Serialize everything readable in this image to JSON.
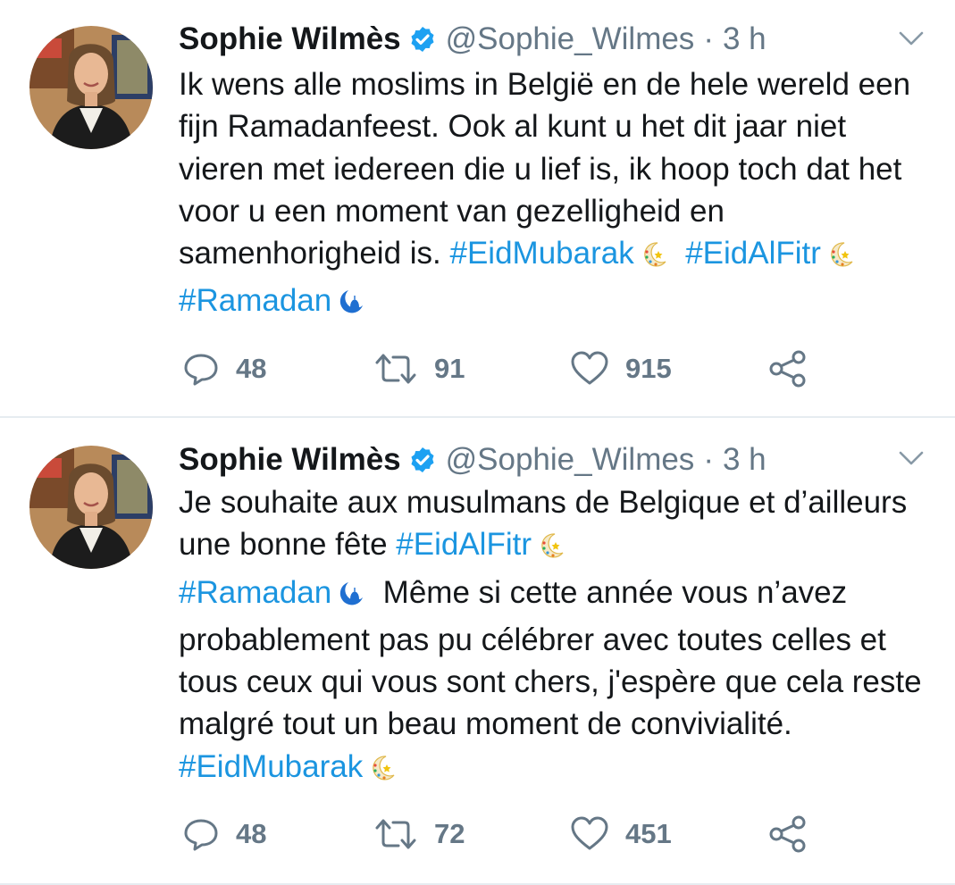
{
  "colors": {
    "text": "#14171a",
    "muted": "#657786",
    "link": "#1b95e0",
    "divider": "#e6ecf0"
  },
  "tweets": [
    {
      "author": {
        "name": "Sophie Wilmès",
        "handle": "@Sophie_Wilmes",
        "verified": true
      },
      "separator": "·",
      "time": "3 h",
      "body": {
        "t1": "Ik wens alle moslims in België en de hele wereld een fijn Ramadanfeest. Ook al kunt u het dit jaar niet vieren met iedereen die u lief is, ik hoop toch dat het voor u een moment van gezelligheid en samenhorigheid is. ",
        "h1": "#EidMubarak",
        "sp1": "  ",
        "h2": "#EidAlFitr",
        "h3": "#Ramadan"
      },
      "stats": {
        "replies": "48",
        "retweets": "91",
        "likes": "915"
      }
    },
    {
      "author": {
        "name": "Sophie Wilmès",
        "handle": "@Sophie_Wilmes",
        "verified": true
      },
      "separator": "·",
      "time": "3 h",
      "body": {
        "t1": "Je souhaite aux musulmans de Belgique et d’ailleurs une bonne fête ",
        "h1": "#EidAlFitr",
        "h2": "#Ramadan",
        "t2": "  Même si cette année vous n’avez probablement pas pu célébrer avec toutes celles et tous ceux qui vous sont chers, j'espère que cela reste malgré tout un beau moment de convivialité. ",
        "h3": "#EidMubarak"
      },
      "stats": {
        "replies": "48",
        "retweets": "72",
        "likes": "451"
      }
    }
  ],
  "icons": {
    "verified": "verified-badge-icon",
    "caret": "chevron-down-icon",
    "reply": "reply-icon",
    "retweet": "retweet-icon",
    "like": "heart-icon",
    "share": "share-icon",
    "crescent_star": "crescent-star-emoji",
    "crescent_mosque": "crescent-mosque-emoji"
  }
}
